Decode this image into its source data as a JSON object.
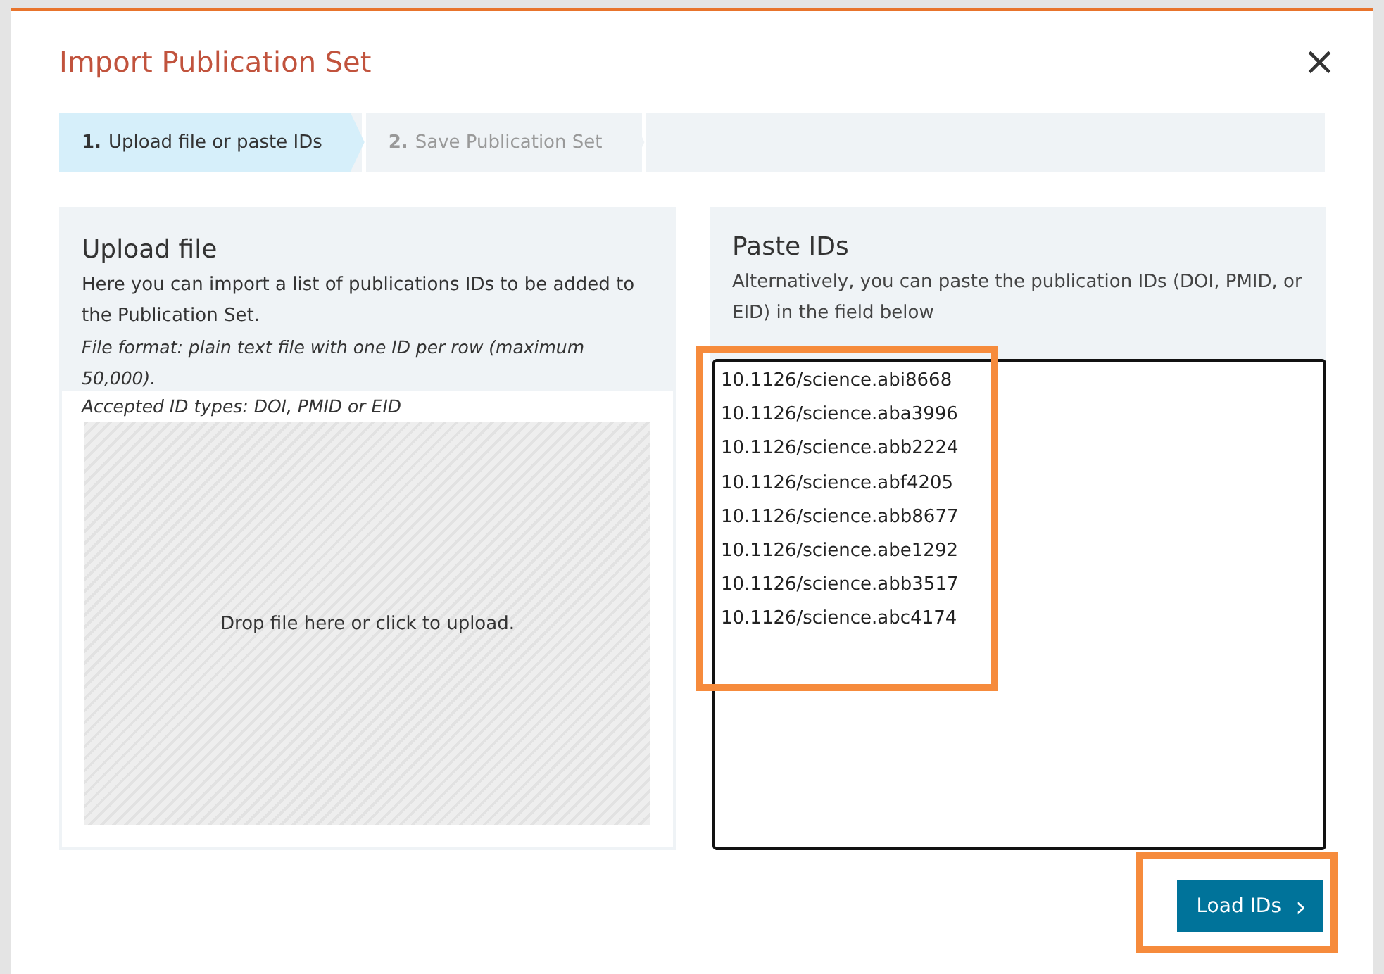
{
  "dialog": {
    "title": "Import Publication Set",
    "close": "×"
  },
  "steps": [
    {
      "number": "1.",
      "label": "Upload file or paste IDs",
      "selected": true
    },
    {
      "number": "2.",
      "label": "Save Publication Set",
      "selected": false
    }
  ],
  "upload": {
    "heading": "Upload file",
    "description": "Here you can import a list of publications IDs to be added to the Publication Set.",
    "format_note": "File format: plain text file with one ID per row (maximum 50,000).",
    "types_note": "Accepted ID types: DOI, PMID or EID",
    "drop_text": "Drop file here or click to upload."
  },
  "paste": {
    "heading": "Paste IDs",
    "description": "Alternatively, you can paste the publication IDs (DOI, PMID, or EID) in the field below",
    "ids": [
      "10.1126/science.abi8668",
      "10.1126/science.aba3996",
      "10.1126/science.abb2224",
      "10.1126/science.abf4205",
      "10.1126/science.abb8677",
      "10.1126/science.abe1292",
      "10.1126/science.abb3517",
      "10.1126/science.abc4174"
    ]
  },
  "button": {
    "label": "Load IDs",
    "icon": "›"
  }
}
